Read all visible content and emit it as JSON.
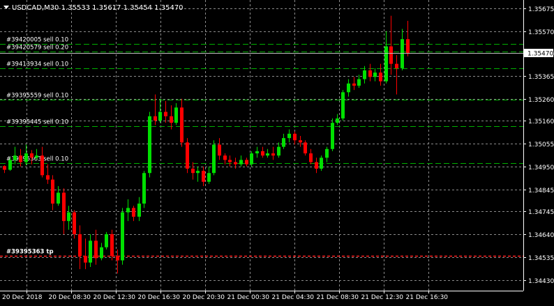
{
  "header": {
    "symbol_info": "USDCAD,M30  1.35533 1.35617 1.35454 1.35470",
    "menu_icon": "triangle-down-icon"
  },
  "colors": {
    "background": "#000000",
    "grid": "#8c8c8c",
    "bull": "#00e000",
    "bear": "#ff0000",
    "order_line": "#00b000",
    "tp_line": "#ff2020",
    "axis_text": "#ffffff",
    "price_tag_bg": "#ffffff",
    "price_tag_text": "#000000"
  },
  "current_price": "1.35470",
  "order_lines": [
    {
      "label": "#39420005 sell 0.10",
      "price": 1.3551
    },
    {
      "label": "#39420579 sell 0.20",
      "price": 1.35475
    },
    {
      "label": "#39413934 sell 0.10",
      "price": 1.354
    },
    {
      "label": "#39395559 sell 0.10",
      "price": 1.35255
    },
    {
      "label": "#39395445 sell 0.10",
      "price": 1.35135
    },
    {
      "label": "#39395363 sell 0.10",
      "price": 1.34965
    }
  ],
  "tp_lines": [
    {
      "label": "#39395363 tp",
      "price": 1.3454
    }
  ],
  "chart_data": {
    "type": "candlestick",
    "title": "USDCAD,M30  1.35533 1.35617 1.35454 1.35470",
    "ylim": [
      1.3441,
      1.3569
    ],
    "y_ticks": [
      "1.35675",
      "1.35570",
      "1.35470",
      "1.35365",
      "1.35260",
      "1.35160",
      "1.35055",
      "1.34950",
      "1.34845",
      "1.34745",
      "1.34640",
      "1.34535",
      "1.34430"
    ],
    "x_ticks": [
      "20 Dec 2018",
      "20 Dec 08:30",
      "20 Dec 12:30",
      "20 Dec 16:30",
      "20 Dec 20:30",
      "21 Dec 00:30",
      "21 Dec 04:30",
      "21 Dec 08:30",
      "21 Dec 12:30",
      "21 Dec 16:30"
    ],
    "candles": [
      [
        1.34952,
        1.34955,
        1.3492,
        1.34935
      ],
      [
        1.34935,
        1.3499,
        1.3493,
        1.3498
      ],
      [
        1.3498,
        1.3504,
        1.3496,
        1.35
      ],
      [
        1.35,
        1.3503,
        1.3495,
        1.3497
      ],
      [
        1.3497,
        1.3505,
        1.34955,
        1.3501
      ],
      [
        1.3501,
        1.35025,
        1.3496,
        1.3499
      ],
      [
        1.3499,
        1.3503,
        1.3498,
        1.35
      ],
      [
        1.35,
        1.3504,
        1.349,
        1.3491
      ],
      [
        1.3491,
        1.3496,
        1.3487,
        1.3489
      ],
      [
        1.3489,
        1.3491,
        1.3475,
        1.3478
      ],
      [
        1.3478,
        1.3486,
        1.3477,
        1.3483
      ],
      [
        1.3483,
        1.3485,
        1.3464,
        1.347
      ],
      [
        1.347,
        1.3477,
        1.3466,
        1.3474
      ],
      [
        1.3474,
        1.3475,
        1.3462,
        1.3464
      ],
      [
        1.3464,
        1.3468,
        1.3448,
        1.3454
      ],
      [
        1.3454,
        1.3462,
        1.3448,
        1.3451
      ],
      [
        1.3451,
        1.3464,
        1.3449,
        1.3461
      ],
      [
        1.3461,
        1.3466,
        1.345,
        1.3453
      ],
      [
        1.3453,
        1.346,
        1.3452,
        1.3458
      ],
      [
        1.3458,
        1.3465,
        1.3457,
        1.3464
      ],
      [
        1.3464,
        1.3466,
        1.3452,
        1.3454
      ],
      [
        1.3454,
        1.3457,
        1.3446,
        1.3452
      ],
      [
        1.3452,
        1.3476,
        1.345,
        1.3474
      ],
      [
        1.3474,
        1.348,
        1.347,
        1.3476
      ],
      [
        1.3476,
        1.3477,
        1.347,
        1.3472
      ],
      [
        1.3472,
        1.3481,
        1.347,
        1.3478
      ],
      [
        1.3478,
        1.3493,
        1.3476,
        1.3492
      ],
      [
        1.3492,
        1.352,
        1.349,
        1.3518
      ],
      [
        1.3518,
        1.3528,
        1.3514,
        1.3516
      ],
      [
        1.3516,
        1.3526,
        1.3515,
        1.352
      ],
      [
        1.352,
        1.3525,
        1.3515,
        1.3518
      ],
      [
        1.3518,
        1.3523,
        1.3512,
        1.3515
      ],
      [
        1.3515,
        1.3524,
        1.3514,
        1.3522
      ],
      [
        1.3522,
        1.3526,
        1.3504,
        1.3506
      ],
      [
        1.3506,
        1.3508,
        1.3492,
        1.3494
      ],
      [
        1.3494,
        1.3497,
        1.3489,
        1.3492
      ],
      [
        1.3492,
        1.3495,
        1.3488,
        1.3493
      ],
      [
        1.3493,
        1.3495,
        1.3486,
        1.3488
      ],
      [
        1.3488,
        1.3495,
        1.3487,
        1.3492
      ],
      [
        1.3492,
        1.3507,
        1.3491,
        1.3505
      ],
      [
        1.3505,
        1.3508,
        1.3498,
        1.35
      ],
      [
        1.35,
        1.3501,
        1.3496,
        1.3498
      ],
      [
        1.3498,
        1.35,
        1.3495,
        1.3497
      ],
      [
        1.3497,
        1.3499,
        1.3494,
        1.3496
      ],
      [
        1.3496,
        1.35,
        1.3495,
        1.3498
      ],
      [
        1.3498,
        1.3499,
        1.3495,
        1.3496
      ],
      [
        1.3496,
        1.3502,
        1.3495,
        1.3501
      ],
      [
        1.3501,
        1.3504,
        1.3499,
        1.3502
      ],
      [
        1.3502,
        1.3504,
        1.3499,
        1.35
      ],
      [
        1.35,
        1.3503,
        1.3499,
        1.3501
      ],
      [
        1.3501,
        1.3504,
        1.3498,
        1.35
      ],
      [
        1.35,
        1.3506,
        1.3499,
        1.3504
      ],
      [
        1.3504,
        1.351,
        1.3503,
        1.3508
      ],
      [
        1.3508,
        1.3512,
        1.3506,
        1.351
      ],
      [
        1.351,
        1.3511,
        1.3505,
        1.3507
      ],
      [
        1.3507,
        1.3509,
        1.3504,
        1.3506
      ],
      [
        1.3506,
        1.3507,
        1.35,
        1.3501
      ],
      [
        1.3501,
        1.3503,
        1.3496,
        1.3497
      ],
      [
        1.3497,
        1.3499,
        1.3492,
        1.3494
      ],
      [
        1.3494,
        1.35,
        1.3493,
        1.3499
      ],
      [
        1.3499,
        1.3504,
        1.3497,
        1.3503
      ],
      [
        1.3503,
        1.3517,
        1.3502,
        1.3515
      ],
      [
        1.3515,
        1.3519,
        1.3514,
        1.3517
      ],
      [
        1.3517,
        1.353,
        1.3516,
        1.3529
      ],
      [
        1.3529,
        1.3535,
        1.3527,
        1.3533
      ],
      [
        1.3533,
        1.3536,
        1.353,
        1.3532
      ],
      [
        1.3532,
        1.3537,
        1.3531,
        1.3535
      ],
      [
        1.3535,
        1.3541,
        1.3533,
        1.3539
      ],
      [
        1.3539,
        1.3542,
        1.3534,
        1.3536
      ],
      [
        1.3536,
        1.354,
        1.3534,
        1.3538
      ],
      [
        1.3538,
        1.3542,
        1.3532,
        1.3534
      ],
      [
        1.3534,
        1.3557,
        1.3533,
        1.355
      ],
      [
        1.355,
        1.3564,
        1.3537,
        1.3542
      ],
      [
        1.3542,
        1.3546,
        1.3528,
        1.354
      ],
      [
        1.354,
        1.3558,
        1.3539,
        1.35533
      ],
      [
        1.35533,
        1.35617,
        1.35454,
        1.3547
      ]
    ]
  }
}
